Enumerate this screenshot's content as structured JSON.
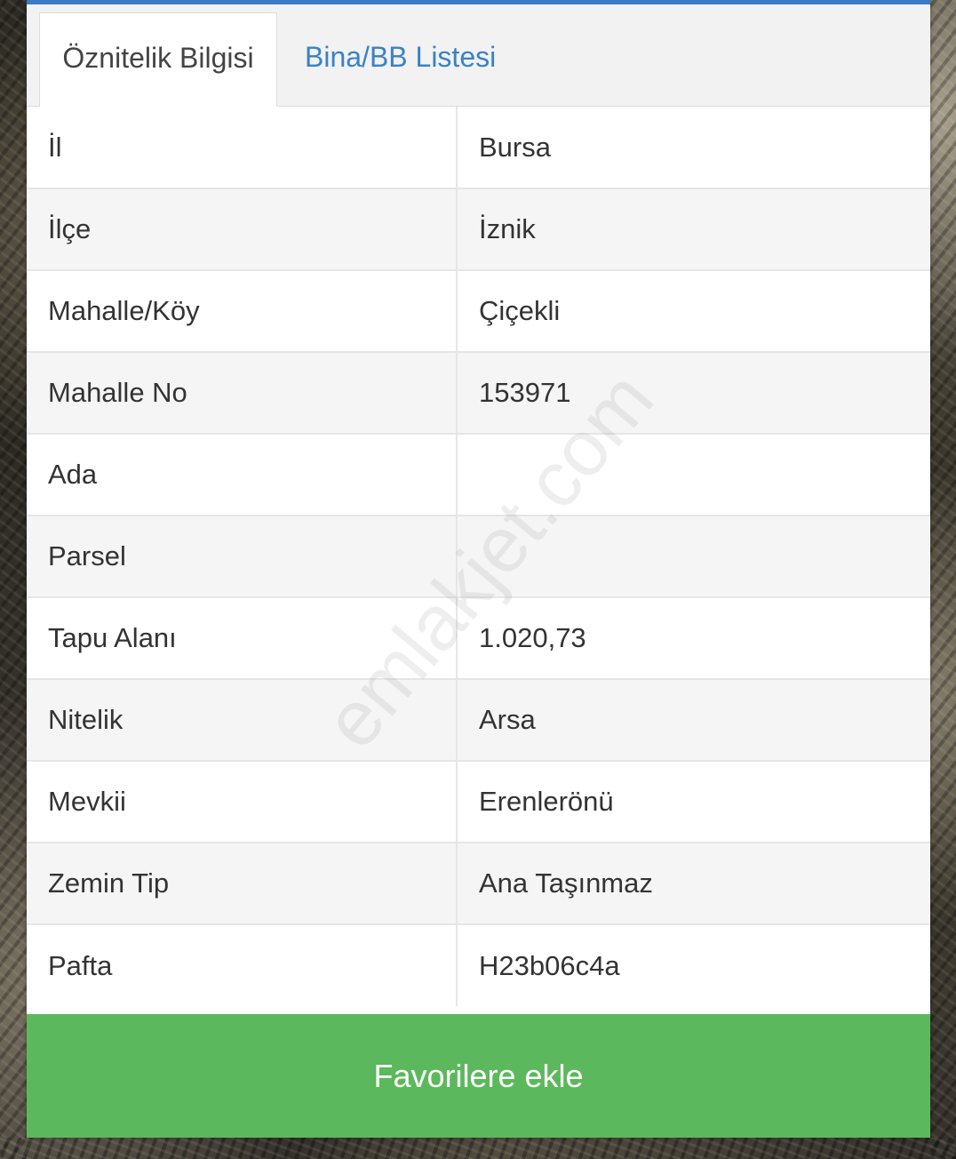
{
  "tabs": [
    {
      "label": "Öznitelik Bilgisi",
      "active": true
    },
    {
      "label": "Bina/BB Listesi",
      "active": false
    }
  ],
  "attributes": [
    {
      "key": "İl",
      "value": "Bursa"
    },
    {
      "key": "İlçe",
      "value": "İznik"
    },
    {
      "key": "Mahalle/Köy",
      "value": "Çiçekli"
    },
    {
      "key": "Mahalle No",
      "value": "153971"
    },
    {
      "key": "Ada",
      "value": ""
    },
    {
      "key": "Parsel",
      "value": ""
    },
    {
      "key": "Tapu Alanı",
      "value": "1.020,73"
    },
    {
      "key": "Nitelik",
      "value": "Arsa"
    },
    {
      "key": "Mevkii",
      "value": "Erenlerönü"
    },
    {
      "key": "Zemin Tip",
      "value": "Ana Taşınmaz"
    },
    {
      "key": "Pafta",
      "value": "H23b06c4a"
    }
  ],
  "favorite_button_label": "Favorilere ekle",
  "watermark": "emlakjet.com",
  "colors": {
    "accent": "#3a7cc4",
    "tab_link": "#3a82c4",
    "button": "#5cb85c"
  }
}
